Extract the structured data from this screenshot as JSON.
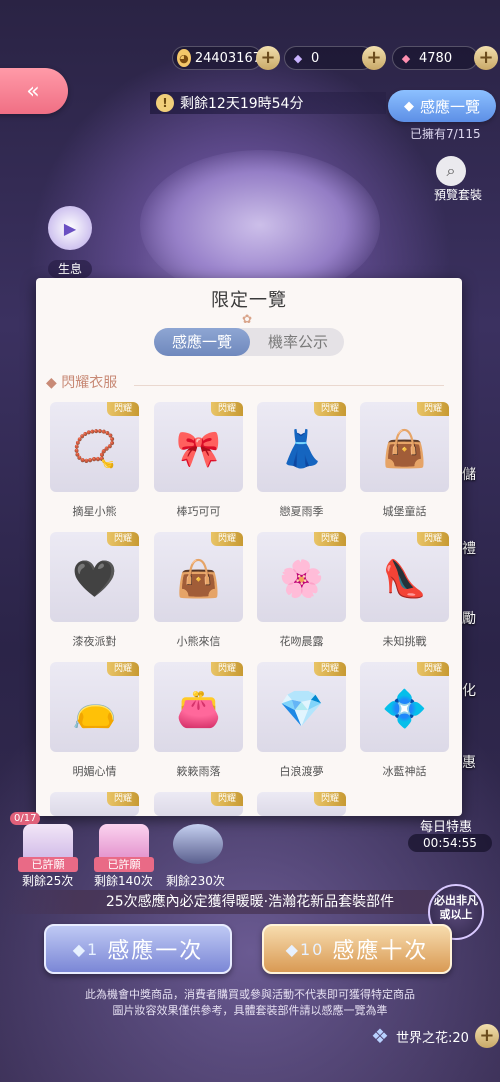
{
  "currency": {
    "coin": "24403167",
    "diamond": "0",
    "gem": "4780"
  },
  "timer": {
    "text": "剩餘12天19時54分"
  },
  "gacha_list_button": "感應一覽",
  "owned": "已擁有7/115",
  "preview_label": "預覽套裝",
  "shengxi_label": "生息",
  "side_items": [
    "儲",
    "禮",
    "勵",
    "化",
    "惠"
  ],
  "dialog": {
    "title": "限定一覽",
    "tabs": [
      "感應一覽",
      "機率公示"
    ],
    "section": "閃耀衣服",
    "tag": "閃耀",
    "items": [
      {
        "name": "摘星小熊",
        "icon": "📿"
      },
      {
        "name": "棒巧可可",
        "icon": "🎀"
      },
      {
        "name": "戀夏雨季",
        "icon": "👗"
      },
      {
        "name": "城堡童話",
        "icon": "👜"
      },
      {
        "name": "漆夜派對",
        "icon": "🖤"
      },
      {
        "name": "小熊來信",
        "icon": "👜"
      },
      {
        "name": "花吻晨露",
        "icon": "🌸"
      },
      {
        "name": "未知挑戰",
        "icon": "👠"
      },
      {
        "name": "明媚心情",
        "icon": "👝"
      },
      {
        "name": "簌簌雨落",
        "icon": "👛"
      },
      {
        "name": "白浪渡夢",
        "icon": "💎"
      },
      {
        "name": "冰藍神話",
        "icon": "💠"
      }
    ]
  },
  "wishes": [
    {
      "status": "已許願",
      "remain": "剩餘25次"
    },
    {
      "status": "已許願",
      "remain": "剩餘140次"
    },
    {
      "status": "",
      "remain": "剩餘230次"
    }
  ],
  "progress": "0/17",
  "daily": {
    "label": "每日特惠",
    "time": "00:54:55"
  },
  "guarantee": "25次感應內必定獲得暖暖·浩瀚花新品套裝部件",
  "badge": "必出非凡或以上",
  "btn_one": {
    "count": "1",
    "label": "感應一次"
  },
  "btn_ten": {
    "count": "10",
    "label": "感應十次"
  },
  "note1": "此為機會中獎商品，消費者購買或參與活動不代表即可獲得特定商品",
  "note2": "圖片妝容效果僅供參考，具體套裝部件請以感應一覽為準",
  "world": "世界之花:20"
}
